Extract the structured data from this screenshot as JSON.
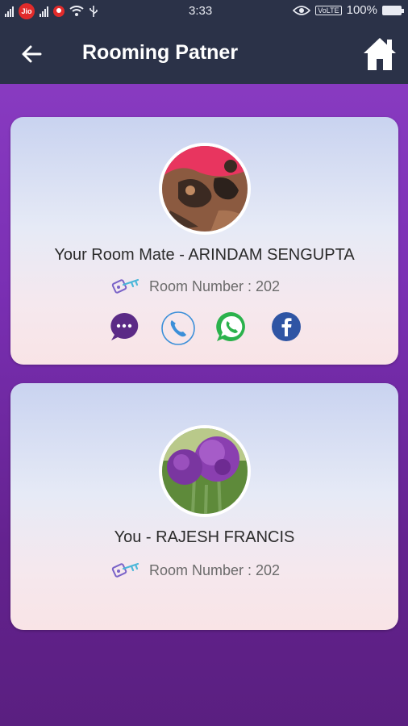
{
  "status_bar": {
    "carrier": "Jio",
    "time": "3:33",
    "volte": "VoLTE",
    "battery": "100%"
  },
  "app_bar": {
    "title": "Rooming Patner",
    "back_icon": "arrow-left-icon",
    "home_icon": "home-icon"
  },
  "cards": [
    {
      "name": "Your Room Mate - ARINDAM  SENGUPTA",
      "room": "Room Number : 202",
      "actions": [
        "message-icon",
        "phone-icon",
        "whatsapp-icon",
        "facebook-icon"
      ]
    },
    {
      "name": "You - RAJESH  FRANCIS",
      "room": "Room Number : 202"
    }
  ],
  "colors": {
    "app_bar": "#2b3248",
    "background": "#7a2fb3",
    "message": "#5b2a86",
    "phone": "#3b8fd9",
    "whatsapp": "#2bb24c",
    "facebook": "#2f55a4"
  }
}
